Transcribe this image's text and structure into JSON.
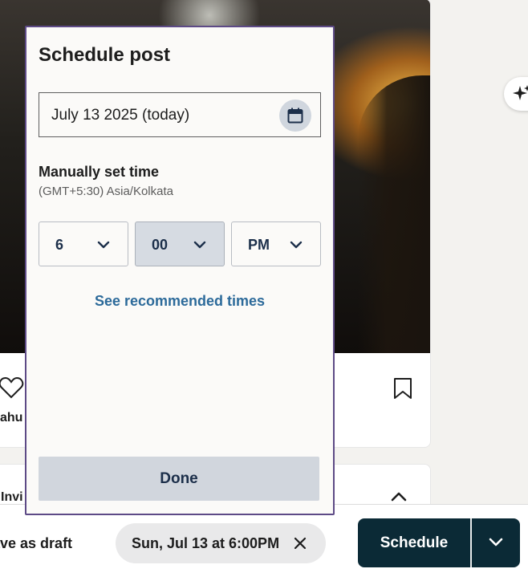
{
  "post": {
    "author_snippet": "ahu",
    "invite_snippet": "Invi"
  },
  "modal": {
    "title": "Schedule post",
    "date_value": "July 13 2025 (today)",
    "section_title": "Manually set time",
    "timezone": "(GMT+5:30) Asia/Kolkata",
    "hour": "6",
    "minute": "00",
    "ampm": "PM",
    "recommended_link": "See recommended times",
    "done_label": "Done"
  },
  "bottom_bar": {
    "save_draft_label": "ave as draft",
    "scheduled_chip": "Sun, Jul 13 at 6:00PM",
    "schedule_label": "Schedule"
  },
  "colors": {
    "modal_border": "#5d4a86",
    "primary_dark": "#0b2a36",
    "link": "#2c6a9a",
    "active_select": "#d6dbe2"
  },
  "icons": [
    "heart-icon",
    "bookmark-icon",
    "chevron-up-icon",
    "sparkle-icon",
    "calendar-icon",
    "chevron-down-icon",
    "close-icon"
  ]
}
